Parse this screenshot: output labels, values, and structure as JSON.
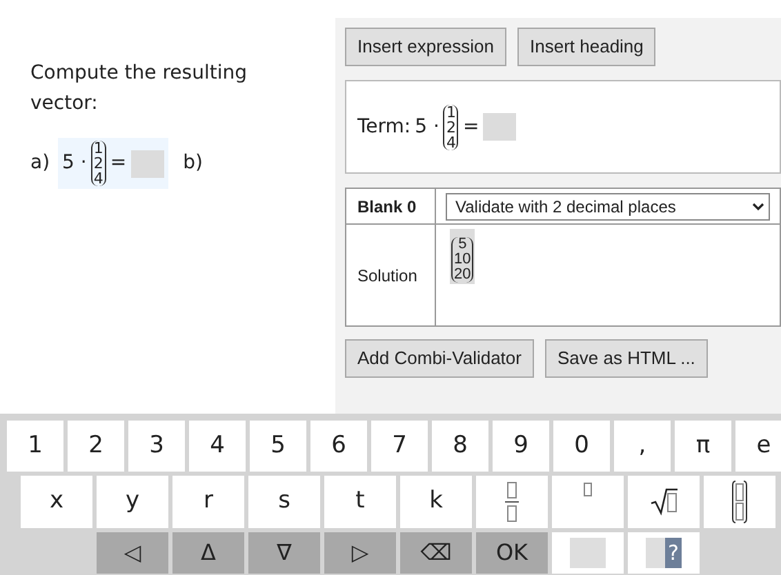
{
  "task": {
    "prompt": "Compute the resulting vector:",
    "items": [
      {
        "label": "a)",
        "parts": [
          {
            "kind": "text",
            "text": "5 ·"
          },
          {
            "kind": "vector",
            "entries": [
              "1",
              "2",
              "4"
            ]
          },
          {
            "kind": "text",
            "text": "="
          },
          {
            "kind": "blank"
          }
        ]
      },
      {
        "label": "b)"
      }
    ]
  },
  "editor": {
    "top_buttons": [
      "Insert expression",
      "Insert heading"
    ],
    "term": {
      "label": "Term:",
      "parts": [
        {
          "kind": "text",
          "text": "5 ·"
        },
        {
          "kind": "vector",
          "entries": [
            "1",
            "2",
            "4"
          ]
        },
        {
          "kind": "text",
          "text": "="
        },
        {
          "kind": "blank"
        }
      ]
    },
    "validator": {
      "blank_label": "Blank 0",
      "mode": "Validate with 2 decimal places",
      "solution_label": "Solution",
      "solution": [
        "5",
        "10",
        "20"
      ]
    },
    "bottom_buttons": [
      "Add Combi-Validator",
      "Save as HTML ..."
    ]
  },
  "keyboard": {
    "number_keys": [
      {
        "kind": "char",
        "label": "1"
      },
      {
        "kind": "char",
        "label": "2"
      },
      {
        "kind": "char",
        "label": "3"
      },
      {
        "kind": "char",
        "label": "4"
      },
      {
        "kind": "char",
        "label": "5"
      },
      {
        "kind": "char",
        "label": "6"
      },
      {
        "kind": "char",
        "label": "7"
      },
      {
        "kind": "char",
        "label": "8"
      },
      {
        "kind": "char",
        "label": "9"
      },
      {
        "kind": "char",
        "label": "0"
      },
      {
        "kind": "char",
        "label": ","
      },
      {
        "kind": "char",
        "label": "π"
      },
      {
        "kind": "char",
        "label": "e"
      }
    ],
    "letter_keys": [
      {
        "kind": "char",
        "label": "x"
      },
      {
        "kind": "char",
        "label": "y"
      },
      {
        "kind": "char",
        "label": "r"
      },
      {
        "kind": "char",
        "label": "s"
      },
      {
        "kind": "char",
        "label": "t"
      },
      {
        "kind": "char",
        "label": "k"
      },
      {
        "kind": "fraction"
      },
      {
        "kind": "power"
      },
      {
        "kind": "root"
      },
      {
        "kind": "matrix"
      }
    ],
    "control_keys": [
      {
        "kind": "spacer"
      },
      {
        "kind": "action",
        "label": "◁"
      },
      {
        "kind": "action",
        "label": "Δ"
      },
      {
        "kind": "action",
        "label": "∇"
      },
      {
        "kind": "action",
        "label": "▷"
      },
      {
        "kind": "action",
        "label": "⌫"
      },
      {
        "kind": "action",
        "label": "OK"
      },
      {
        "kind": "slot"
      },
      {
        "kind": "slot",
        "label": "?"
      }
    ]
  }
}
